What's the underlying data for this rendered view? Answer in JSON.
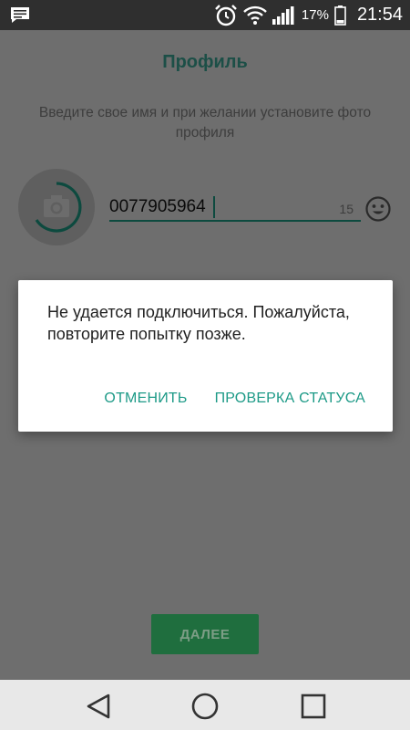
{
  "status_bar": {
    "battery_percent": "17%",
    "time": "21:54",
    "icons": [
      "message-icon",
      "alarm-icon",
      "wifi-icon",
      "signal-icon",
      "battery-icon"
    ]
  },
  "profile": {
    "title": "Профиль",
    "subtitle": "Введите свое имя и при желании установите фото профиля",
    "name_value": "0077905964",
    "char_counter": "15",
    "next_button": "ДАЛЕЕ"
  },
  "dialog": {
    "message": "Не удается подключиться. Пожалуйста, повторите попытку позже.",
    "cancel_label": "ОТМЕНИТЬ",
    "check_status_label": "ПРОВЕРКА СТАТУСА"
  },
  "nav_bar": {
    "icons": [
      "back-icon",
      "home-icon",
      "recents-icon"
    ]
  },
  "colors": {
    "accent": "#1d9a87",
    "title_dark": "#1c4f47",
    "next_button": "#1f6e3e",
    "scrim_bg": "#6e6e6e",
    "status_bar": "#2f2f2f",
    "nav_bar": "#e8e8e8"
  }
}
